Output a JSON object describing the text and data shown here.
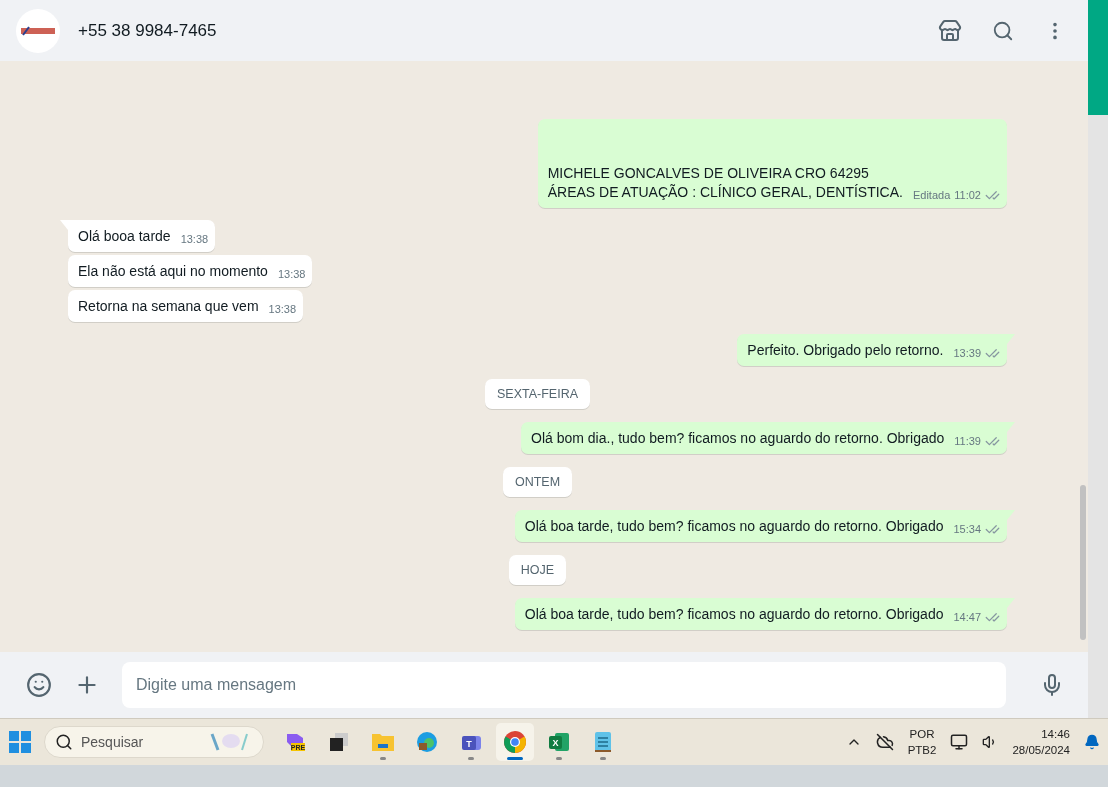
{
  "header": {
    "contact": "+55 38 9984-7465"
  },
  "messages": [
    {
      "kind": "out",
      "tail": false,
      "lines": [
        "MICHELE GONCALVES DE OLIVEIRA CRO 64295",
        "ÁREAS DE ATUAÇÃO : CLÍNICO GERAL, DENTÍSTICA."
      ],
      "edited": "Editada",
      "time": "11:02"
    },
    {
      "kind": "in",
      "tail": true,
      "lines": [
        "Olá booa tarde"
      ],
      "time": "13:38"
    },
    {
      "kind": "in",
      "tail": false,
      "lines": [
        "Ela não está aqui no momento"
      ],
      "time": "13:38"
    },
    {
      "kind": "in",
      "tail": false,
      "lines": [
        "Retorna na semana que vem"
      ],
      "time": "13:38"
    },
    {
      "kind": "out",
      "tail": true,
      "lines": [
        "Perfeito. Obrigado pelo retorno."
      ],
      "time": "13:39"
    },
    {
      "kind": "date",
      "label": "SEXTA-FEIRA"
    },
    {
      "kind": "out",
      "tail": true,
      "lines": [
        "Olá bom dia., tudo bem? ficamos no aguardo do retorno. Obrigado"
      ],
      "time": "11:39"
    },
    {
      "kind": "date",
      "label": "ONTEM"
    },
    {
      "kind": "out",
      "tail": true,
      "lines": [
        "Olá boa tarde, tudo bem? ficamos no aguardo do retorno. Obrigado"
      ],
      "time": "15:34"
    },
    {
      "kind": "date",
      "label": "HOJE"
    },
    {
      "kind": "out",
      "tail": true,
      "lines": [
        "Olá boa tarde, tudo bem? ficamos no aguardo do retorno. Obrigado"
      ],
      "time": "14:47"
    }
  ],
  "composer": {
    "placeholder": "Digite uma mensagem"
  },
  "taskbar": {
    "search_placeholder": "Pesquisar",
    "apps": [
      {
        "kind": "copilot",
        "badge": "PRE",
        "running": false,
        "selected": false
      },
      {
        "kind": "taskview",
        "running": false,
        "selected": false
      },
      {
        "kind": "folder",
        "running": true,
        "selected": false
      },
      {
        "kind": "edge",
        "running": false,
        "selected": false
      },
      {
        "kind": "teams",
        "badge": "T",
        "running": true,
        "selected": false
      },
      {
        "kind": "chrome",
        "running": true,
        "selected": true
      },
      {
        "kind": "excel",
        "badge": "X",
        "running": true,
        "selected": false
      },
      {
        "kind": "notepad",
        "running": true,
        "selected": false
      }
    ],
    "language": "POR",
    "layout": "PTB2",
    "time": "14:46",
    "date": "28/05/2024"
  }
}
